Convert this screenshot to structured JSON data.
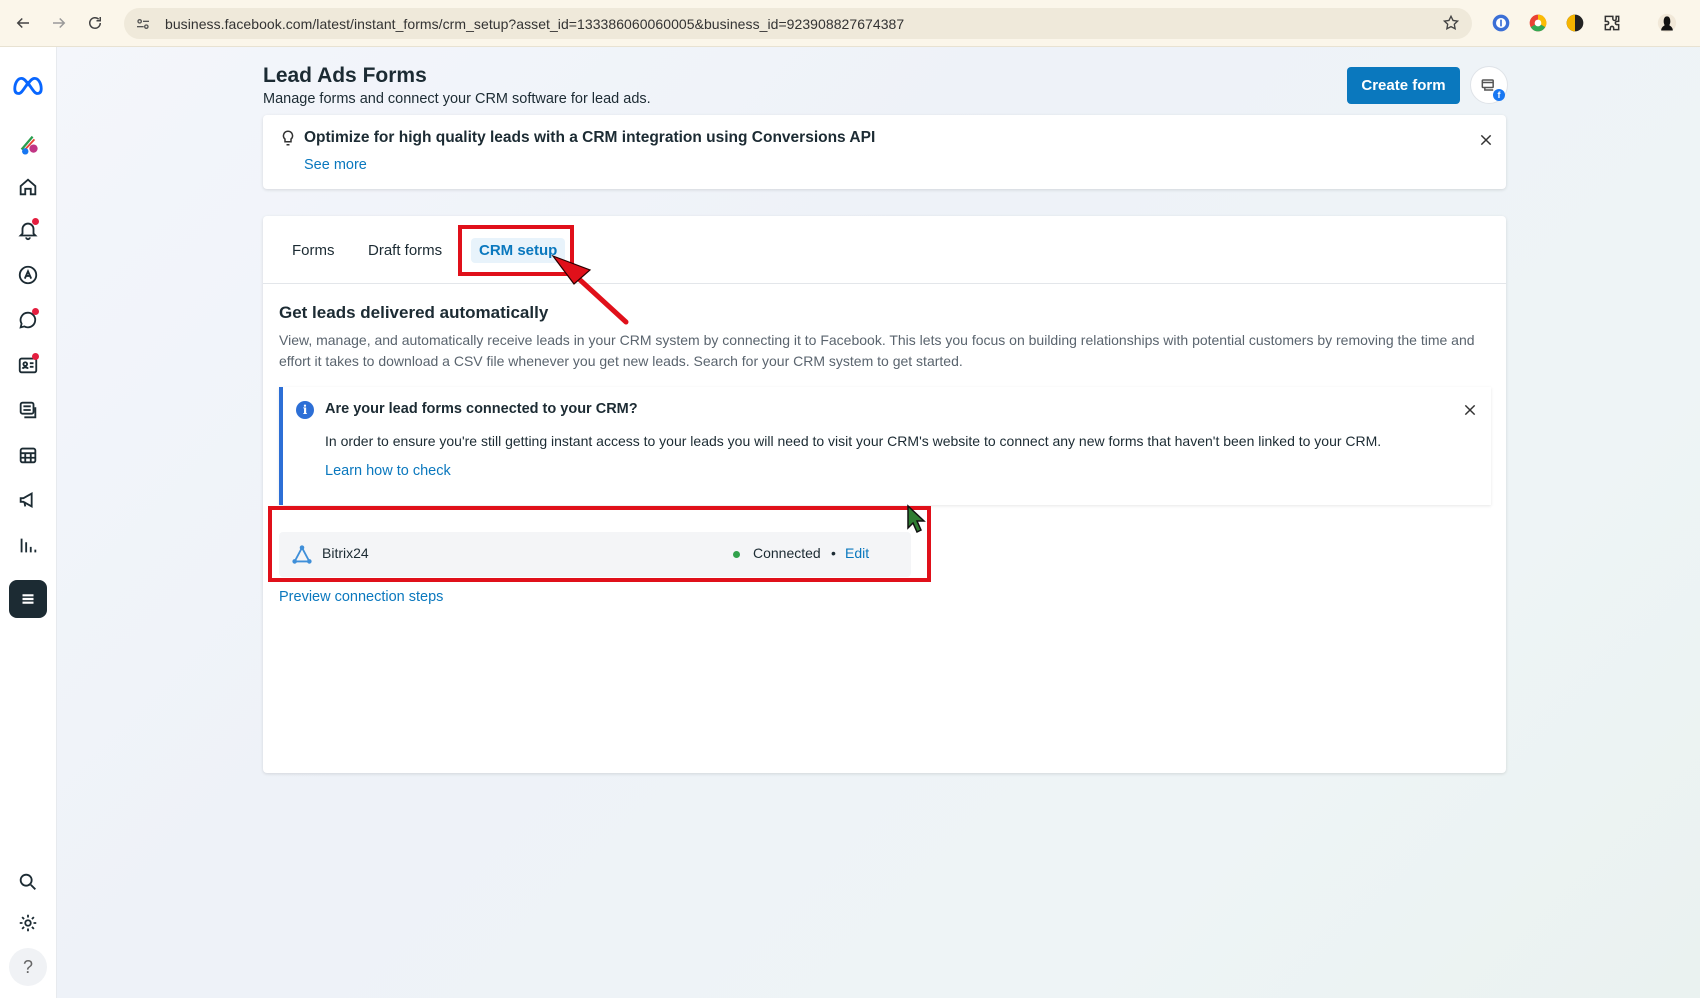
{
  "browser": {
    "url": "business.facebook.com/latest/instant_forms/crm_setup?asset_id=133386060060005&business_id=923908827674387"
  },
  "header": {
    "title": "Lead Ads Forms",
    "subtitle": "Manage forms and connect your CRM software for lead ads.",
    "create_button": "Create form"
  },
  "banner": {
    "title": "Optimize for high quality leads with a CRM integration using Conversions API",
    "link": "See more"
  },
  "tabs": [
    {
      "label": "Forms"
    },
    {
      "label": "Draft forms"
    },
    {
      "label": "CRM setup"
    }
  ],
  "section": {
    "title": "Get leads delivered automatically",
    "description": "View, manage, and automatically receive leads in your CRM system by connecting it to Facebook. This lets you focus on building relationships with potential customers by removing the time and effort it takes to download a CSV file whenever you get new leads. Search for your CRM system to get started."
  },
  "info": {
    "title": "Are your lead forms connected to your CRM?",
    "body": "In order to ensure you're still getting instant access to your leads you will need to visit your CRM's website to connect any new forms that haven't been linked to your CRM.",
    "link": "Learn how to check"
  },
  "crm": {
    "name": "Bitrix24",
    "status": "Connected",
    "separator": "•",
    "edit": "Edit"
  },
  "preview_link": "Preview connection steps",
  "help_label": "?",
  "colors": {
    "accent": "#0a78be",
    "annotation": "#e0101a",
    "connected": "#31a24c",
    "info": "#2d6fd6"
  }
}
